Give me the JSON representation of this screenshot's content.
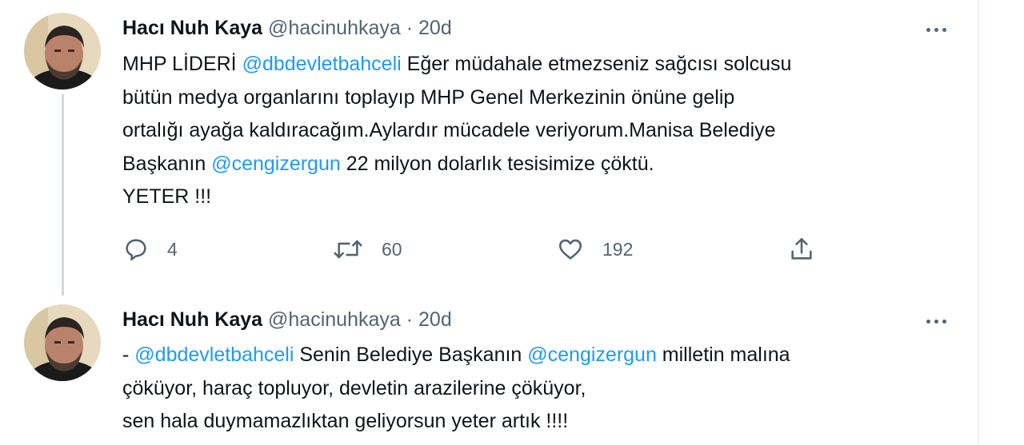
{
  "tweets": [
    {
      "name": "Hacı Nuh Kaya",
      "handle": "@hacinuhkaya",
      "dot": "·",
      "time": "20d",
      "lines": [
        [
          {
            "text": "MHP LİDERİ  ",
            "type": "text"
          },
          {
            "text": "@dbdevletbahceli",
            "type": "mention"
          },
          {
            "text": " Eğer müdahale etmezseniz sağcısı solcusu",
            "type": "text"
          }
        ],
        [
          {
            "text": "bütün medya organlarını toplayıp MHP Genel Merkezinin  önüne gelip",
            "type": "text"
          }
        ],
        [
          {
            "text": "ortalığı ayağa kaldıracağım.Aylardır mücadele veriyorum.Manisa Belediye",
            "type": "text"
          }
        ],
        [
          {
            "text": "Başkanın ",
            "type": "text"
          },
          {
            "text": "@cengizergun",
            "type": "mention"
          },
          {
            "text": " 22 milyon dolarlık tesisimize çöktü.",
            "type": "text"
          }
        ],
        [
          {
            "text": "YETER !!!",
            "type": "text"
          }
        ]
      ],
      "actions": {
        "replies": "4",
        "retweets": "60",
        "likes": "192"
      }
    },
    {
      "name": "Hacı Nuh Kaya",
      "handle": "@hacinuhkaya",
      "dot": "·",
      "time": "20d",
      "lines": [
        [
          {
            "text": "- ",
            "type": "text"
          },
          {
            "text": "@dbdevletbahceli",
            "type": "mention"
          },
          {
            "text": " Senin Belediye Başkanın ",
            "type": "text"
          },
          {
            "text": "@cengizergun",
            "type": "mention"
          },
          {
            "text": " milletin malına",
            "type": "text"
          }
        ],
        [
          {
            "text": "çöküyor, haraç topluyor, devletin arazilerine çöküyor,",
            "type": "text"
          }
        ],
        [
          {
            "text": "sen hala duymamazlıktan geliyorsun yeter artık !!!!",
            "type": "text"
          }
        ]
      ]
    }
  ],
  "icons": {
    "reply": "reply-icon",
    "retweet": "retweet-icon",
    "like": "heart-icon",
    "share": "share-icon",
    "more": "more-icon"
  },
  "colors": {
    "link": "#1d9bf0",
    "secondary_text": "#536471",
    "primary_text": "#0f1419",
    "thread_line": "#cfd9de"
  }
}
